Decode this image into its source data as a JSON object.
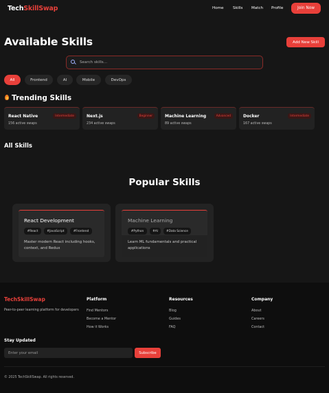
{
  "nav": {
    "brand_part1": "Tech",
    "brand_part2": "SkillSwap",
    "links": [
      "Home",
      "Skills",
      "Match",
      "Profile"
    ],
    "join_label": "Join Now"
  },
  "header": {
    "title": "Available Skills",
    "add_label": "Add New Skill"
  },
  "search": {
    "placeholder": "Search skills..."
  },
  "filters": [
    "All",
    "Frontend",
    "AI",
    "Mobile",
    "DevOps"
  ],
  "trending": {
    "title": "Trending Skills",
    "cards": [
      {
        "name": "React Native",
        "level": "Intermediate",
        "swaps": "156 active swaps"
      },
      {
        "name": "Next.js",
        "level": "Beginner",
        "swaps": "234 active swaps"
      },
      {
        "name": "Machine Learning",
        "level": "Advanced",
        "swaps": "89 active swaps"
      },
      {
        "name": "Docker",
        "level": "Intermediate",
        "swaps": "167 active swaps"
      }
    ]
  },
  "all_skills": {
    "title": "All Skills"
  },
  "popular": {
    "title": "Popular Skills",
    "cards": [
      {
        "title": "React Development",
        "tags": [
          "#React",
          "#JavaScript",
          "#Frontend"
        ],
        "desc_line1": "Master modern React including hooks,",
        "desc_line2": "context, and Redux"
      },
      {
        "title": "Machine Learning",
        "tags": [
          "#Python",
          "#AI",
          "#Data Science"
        ],
        "desc_line1": "Learn ML fundamentals and practical",
        "desc_line2": "applications"
      }
    ]
  },
  "footer": {
    "brand": "TechSkillSwap",
    "tagline": "Peer-to-peer learning platform for developers",
    "columns": [
      {
        "title": "Platform",
        "links": [
          "Find Mentors",
          "Become a Mentor",
          "How it Works"
        ]
      },
      {
        "title": "Resources",
        "links": [
          "Blog",
          "Guides",
          "FAQ"
        ]
      },
      {
        "title": "Company",
        "links": [
          "About",
          "Careers",
          "Contact"
        ]
      }
    ],
    "newsletter_title": "Stay Updated",
    "email_placeholder": "Enter your email",
    "subscribe_label": "Subscribe",
    "copyright": "© 2025 TechSkillSwap. All rights reserved."
  },
  "colors": {
    "accent": "#e8403a",
    "background": "#161616",
    "footer_bg": "#0e0e0e",
    "card_bg": "#222222"
  }
}
